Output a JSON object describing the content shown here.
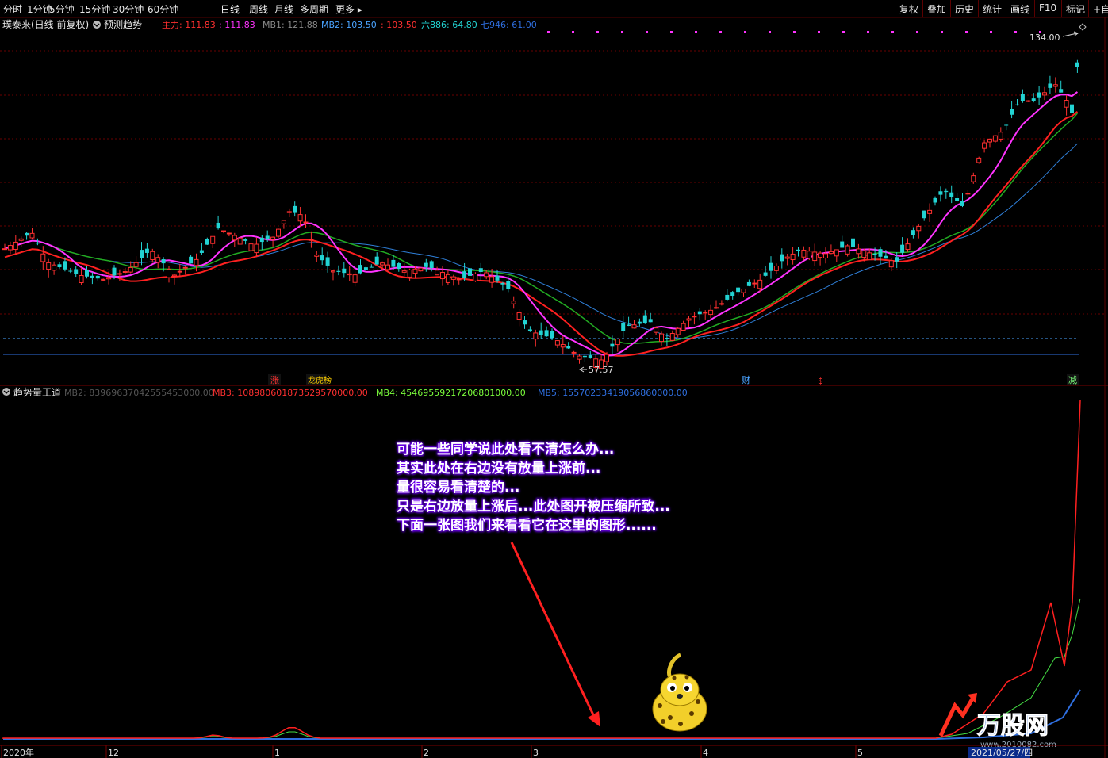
{
  "toolbar": {
    "periods": [
      "分时",
      "1分钟",
      "5分钟",
      "15分钟",
      "30分钟",
      "60分钟",
      "日线",
      "周线",
      "月线",
      "多周期",
      "更多"
    ],
    "active_period": "日线",
    "more_arrow": "▸",
    "right_tabs": [
      "复权",
      "叠加",
      "历史",
      "统计",
      "画线",
      "F10",
      "标记",
      "+自选"
    ]
  },
  "main_header": {
    "stock": "璞泰来(日线 前复权)",
    "forecast": "预测趋势",
    "zhuli": "主力: 111.83",
    "zhuli2": ": 111.83",
    "mb1": "MB1: 121.88",
    "mb2": "MB2: 103.50",
    "mb2b": ": 103.50",
    "liu": "六886: 64.80",
    "qi": "七946: 61.00"
  },
  "price_labels": {
    "high": "134.00",
    "low": "57.57"
  },
  "event_markers": [
    {
      "text": "涨",
      "color": "#ff3030"
    },
    {
      "text": "龙虎榜",
      "color": "#ffd000"
    },
    {
      "text": "财",
      "color": "#4aa3ff"
    },
    {
      "text": "$",
      "color": "#ff3030"
    },
    {
      "text": "减",
      "color": "#7cff7c"
    }
  ],
  "indicator_header": {
    "name": "趋势量王道",
    "mb2": "MB2: 83969637042555453000.00",
    "mb3": "MB3: 108980601873529570000.00",
    "mb4": "MB4: 45469559217206801000.00",
    "mb5": "MB5: 15570233419056860000.00"
  },
  "annotation_lines": [
    "可能一些同学说此处看不清怎么办...",
    "其实此处在右边没有放量上涨前...",
    "量很容易看清楚的...",
    "只是右边放量上涨后...此处图开被压缩所致...",
    "下面一张图我们来看看它在这里的图形......"
  ],
  "x_axis": [
    "2020年",
    "12",
    "1",
    "2",
    "3",
    "4",
    "5"
  ],
  "date_badge": "2021/05/27/四",
  "watermark": {
    "brand": "万股网",
    "url": "www.2010082.com"
  },
  "colors": {
    "up": "#ff3030",
    "down": "#22d3d3",
    "ma_short": "#ff33ff",
    "ma_mid": "#ff2020",
    "ma_green": "#22aa22",
    "ma_blue": "#2f7fd8"
  },
  "chart_data": {
    "type": "candlestick",
    "title": "璞泰来(日线 前复权)",
    "x_range": [
      "2020年",
      "2021/05/27"
    ],
    "y_range": [
      57.57,
      134.0
    ],
    "annotated_high": 134.0,
    "annotated_low": 57.57,
    "indicator_series": [
      {
        "name": "MB2",
        "last_value": "83969637042555453000.00"
      },
      {
        "name": "MB3",
        "last_value": "108980601873529570000.00"
      },
      {
        "name": "MB4",
        "last_value": "45469559217206801000.00"
      },
      {
        "name": "MB5",
        "last_value": "15570233419056860000.00"
      }
    ]
  }
}
